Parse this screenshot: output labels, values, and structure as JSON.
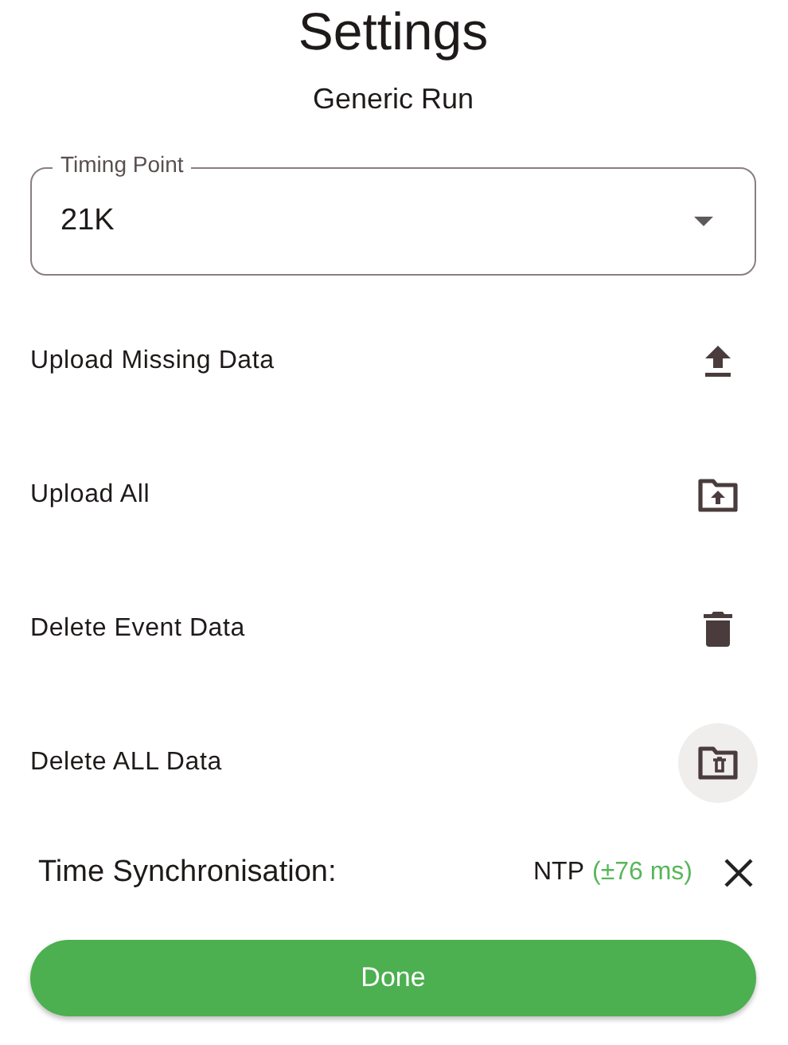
{
  "title": "Settings",
  "subtitle": "Generic Run",
  "timing_point": {
    "label": "Timing Point",
    "value": "21K"
  },
  "actions": [
    {
      "label": "Upload Missing Data",
      "kind": "upload",
      "highlighted": false
    },
    {
      "label": "Upload All",
      "kind": "folder-upload",
      "highlighted": false
    },
    {
      "label": "Delete Event Data",
      "kind": "delete",
      "highlighted": false
    },
    {
      "label": "Delete ALL Data",
      "kind": "folder-delete",
      "highlighted": true
    }
  ],
  "time_sync": {
    "label": "Time Synchronisation:",
    "method": "NTP",
    "accuracy": "(±76 ms)"
  },
  "done_button": "Done"
}
